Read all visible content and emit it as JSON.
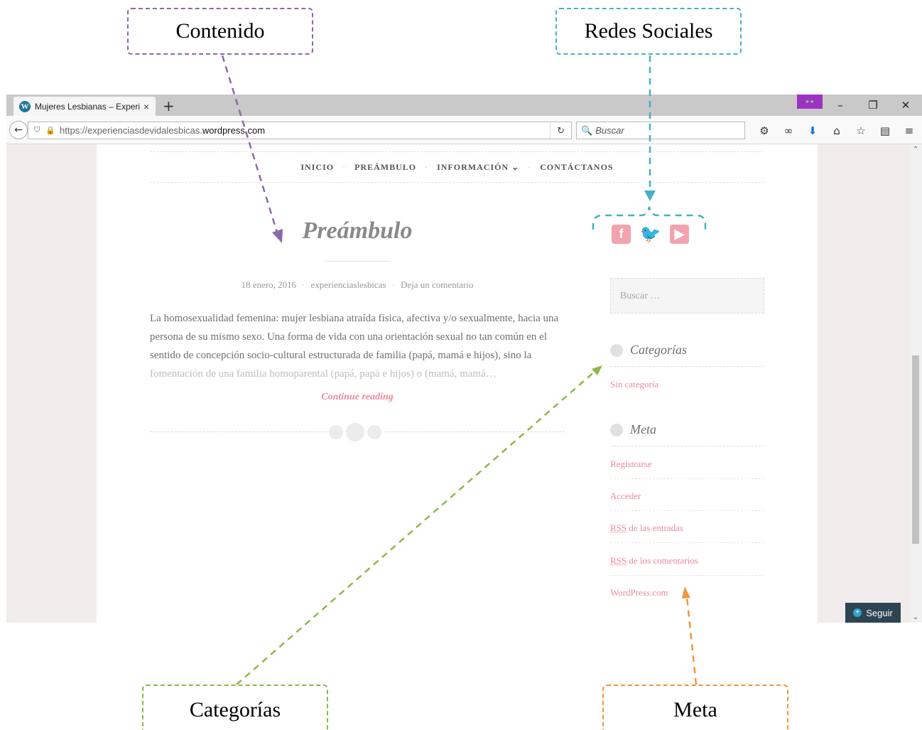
{
  "annotations": {
    "contenido": "Contenido",
    "redes_sociales": "Redes Sociales",
    "categorias": "Categorías",
    "meta": "Meta"
  },
  "browser": {
    "tab_title": "Mujeres Lesbianas – Experi...",
    "tab_close": "×",
    "new_tab": "+",
    "url_prefix": "https://experienciasdevidalesbicas.",
    "url_domain": "wordpress.com",
    "search_placeholder": "Buscar",
    "window_controls": [
      "–",
      "❐",
      "✕"
    ],
    "toolbar_icons": [
      "gear-icon",
      "mask-icon",
      "download-icon",
      "home-icon",
      "star-icon",
      "clipboard-icon",
      "menu-icon"
    ]
  },
  "site": {
    "menu": [
      "INICIO",
      "PREÁMBULO",
      "INFORMACIÓN ⌄",
      "CONTÁCTANOS"
    ],
    "menu_sep": "·",
    "post": {
      "title": "Preámbulo",
      "date": "18 enero, 2016",
      "author": "experienciaslesbicas",
      "comments": "Deja un comentario",
      "body_main": "La homosexualidad femenina: mujer lesbiana atraída física, afectiva y/o sexualmente, hacia una persona de su mismo sexo. Una forma de vida con una orientación sexual no tan común en el sentido de concepción socio-cultural estructurada de familia (papá, mamá e hijos), sino la ",
      "body_fade": "fomentación de una familia homoparental (papá, papá e hijos) o (mamá, mamá…",
      "continue": "Continue reading"
    },
    "social": {
      "facebook": "f",
      "twitter": "🐦",
      "youtube": "▶"
    },
    "search_placeholder": "Buscar …",
    "categories": {
      "title": "Categorías",
      "items": [
        "Sin categoría"
      ]
    },
    "meta": {
      "title": "Meta",
      "register": "Registrarse",
      "login": "Acceder",
      "rss_abbr": "RSS",
      "rss_entries_suffix": " de las entradas",
      "rss_comments_suffix": " de los comentarios",
      "wordpress": "WordPress.com"
    },
    "follow": "Seguir"
  },
  "colors": {
    "contenido": "#8a6aa8",
    "redes": "#45b1c4",
    "categorias": "#8db84a",
    "meta": "#f0953c",
    "accent_pink": "#ef8a9a"
  }
}
